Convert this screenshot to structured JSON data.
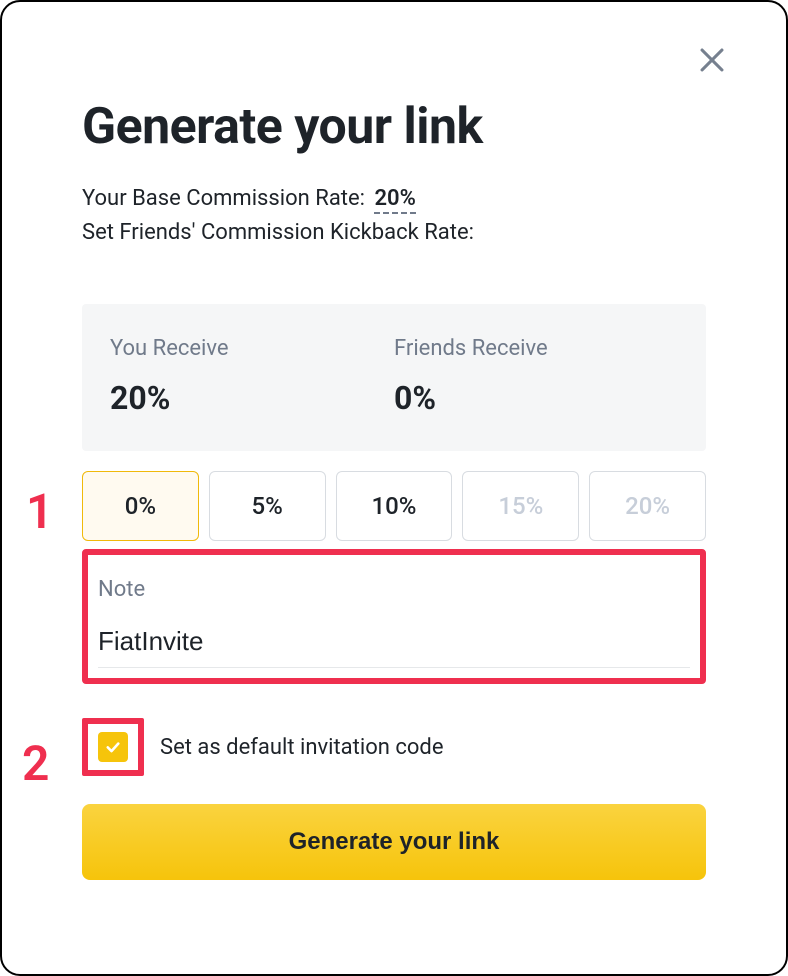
{
  "modal": {
    "title": "Generate your link",
    "base_rate_label": "Your Base Commission Rate:",
    "base_rate_value": "20%",
    "kickback_label": "Set Friends' Commission Kickback Rate:"
  },
  "distribution": {
    "you_label": "You Receive",
    "you_value": "20%",
    "friends_label": "Friends Receive",
    "friends_value": "0%"
  },
  "kickback_options": [
    {
      "label": "0%",
      "state": "selected"
    },
    {
      "label": "5%",
      "state": "enabled"
    },
    {
      "label": "10%",
      "state": "enabled"
    },
    {
      "label": "15%",
      "state": "disabled"
    },
    {
      "label": "20%",
      "state": "disabled"
    }
  ],
  "note": {
    "label": "Note",
    "value": "FiatInvite"
  },
  "default_checkbox": {
    "checked": true,
    "label": "Set as default invitation code"
  },
  "cta": {
    "label": "Generate your link"
  },
  "annotations": {
    "one": "1",
    "two": "2"
  }
}
